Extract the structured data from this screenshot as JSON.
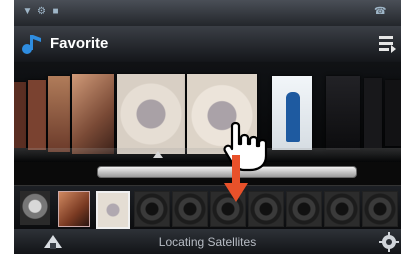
{
  "header": {
    "title": "Favorite"
  },
  "status_bar": {
    "icons": [
      "antenna-icon",
      "gear-small-icon",
      "message-icon",
      "phone-icon"
    ]
  },
  "carousel": {
    "albums": [
      {
        "name": "album-1",
        "color": "#6b3a2a"
      },
      {
        "name": "album-2",
        "color": "#8a4c32"
      },
      {
        "name": "album-3",
        "color": "#c09070"
      },
      {
        "name": "album-4",
        "color": "#d8d2c8"
      },
      {
        "name": "album-5",
        "color": "#e0dad0"
      },
      {
        "name": "album-6",
        "color": "#eef3f7"
      },
      {
        "name": "album-7",
        "color": "#1a1a1c"
      },
      {
        "name": "album-8",
        "color": "#141416"
      }
    ]
  },
  "thumbstrip": {
    "thumbs": [
      "thumb-1",
      "thumb-2",
      "thumb-3"
    ],
    "empty_slots": 7
  },
  "bottom_bar": {
    "status_text": "Locating Satellites"
  },
  "colors": {
    "accent_arrow": "#e8512a",
    "title_text": "#ffffff"
  }
}
